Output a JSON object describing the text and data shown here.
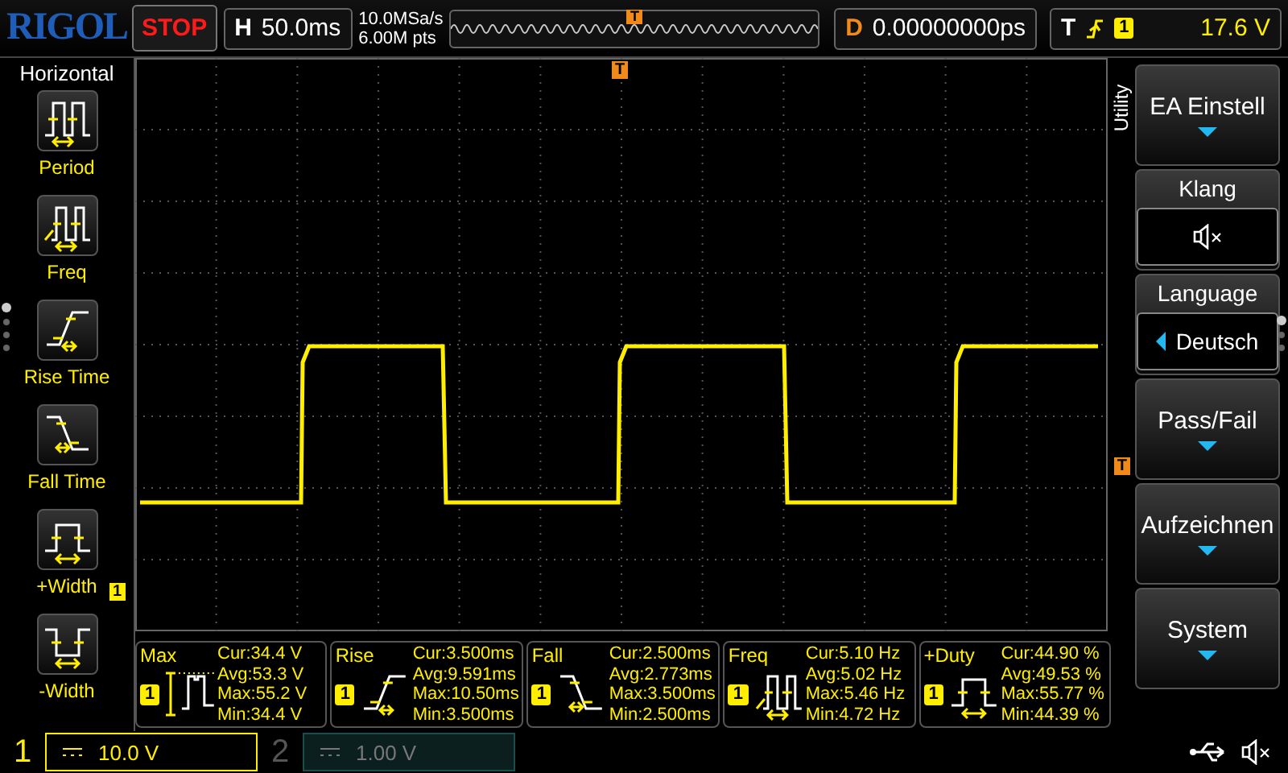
{
  "top_bar": {
    "logo": "RIGOL",
    "run_state": "STOP",
    "timebase": {
      "label": "H",
      "value": "50.0ms"
    },
    "sample_rate": "10.0MSa/s",
    "memory_depth": "6.00M pts",
    "memory_marker": "T",
    "delay": {
      "label": "D",
      "value": "0.00000000ps"
    },
    "trigger": {
      "label": "T",
      "channel": "1",
      "level": "17.6 V"
    }
  },
  "graticule": {
    "trigger_position_marker": "T",
    "trigger_level_marker": "T",
    "channel_marker": "1"
  },
  "left_menu": {
    "title": "Horizontal",
    "pages": [
      {
        "selected": true
      },
      {
        "selected": false
      },
      {
        "selected": false
      },
      {
        "selected": false
      }
    ],
    "items": [
      {
        "label": "Period",
        "kind": "period"
      },
      {
        "label": "Freq",
        "kind": "freq"
      },
      {
        "label": "Rise Time",
        "kind": "rise"
      },
      {
        "label": "Fall Time",
        "kind": "fall"
      },
      {
        "label": "+Width",
        "kind": "pwidth"
      },
      {
        "label": "-Width",
        "kind": "nwidth"
      }
    ]
  },
  "measurements": [
    {
      "label": "Max",
      "channel": "1",
      "kind": "max",
      "cur": "Cur:34.4 V",
      "avg": "Avg:53.3 V",
      "max": "Max:55.2 V",
      "min": "Min:34.4 V"
    },
    {
      "label": "Rise",
      "channel": "1",
      "kind": "rise",
      "cur": "Cur:3.500ms",
      "avg": "Avg:9.591ms",
      "max": "Max:10.50ms",
      "min": "Min:3.500ms"
    },
    {
      "label": "Fall",
      "channel": "1",
      "kind": "fall",
      "cur": "Cur:2.500ms",
      "avg": "Avg:2.773ms",
      "max": "Max:3.500ms",
      "min": "Min:2.500ms"
    },
    {
      "label": "Freq",
      "channel": "1",
      "kind": "freq",
      "cur": "Cur:5.10 Hz",
      "avg": "Avg:5.02 Hz",
      "max": "Max:5.46 Hz",
      "min": "Min:4.72 Hz"
    },
    {
      "label": "+Duty",
      "channel": "1",
      "kind": "duty",
      "cur": "Cur:44.90 %",
      "avg": "Avg:49.53 %",
      "max": "Max:55.77 %",
      "min": "Min:44.39 %"
    }
  ],
  "right_menu": {
    "title": "Utility",
    "pages": [
      {
        "selected": true
      },
      {
        "selected": false
      },
      {
        "selected": false
      }
    ],
    "items": [
      {
        "label": "EA Einstell",
        "kind": "submenu"
      },
      {
        "label": "Klang",
        "kind": "sound"
      },
      {
        "label": "Language",
        "kind": "choice",
        "value": "Deutsch"
      },
      {
        "label": "Pass/Fail",
        "kind": "submenu"
      },
      {
        "label": "Aufzeichnen",
        "kind": "submenu"
      },
      {
        "label": "System",
        "kind": "submenu"
      }
    ]
  },
  "channels": [
    {
      "number": "1",
      "scale": "10.0 V",
      "enabled": true
    },
    {
      "number": "2",
      "scale": "1.00 V",
      "enabled": false
    }
  ]
}
